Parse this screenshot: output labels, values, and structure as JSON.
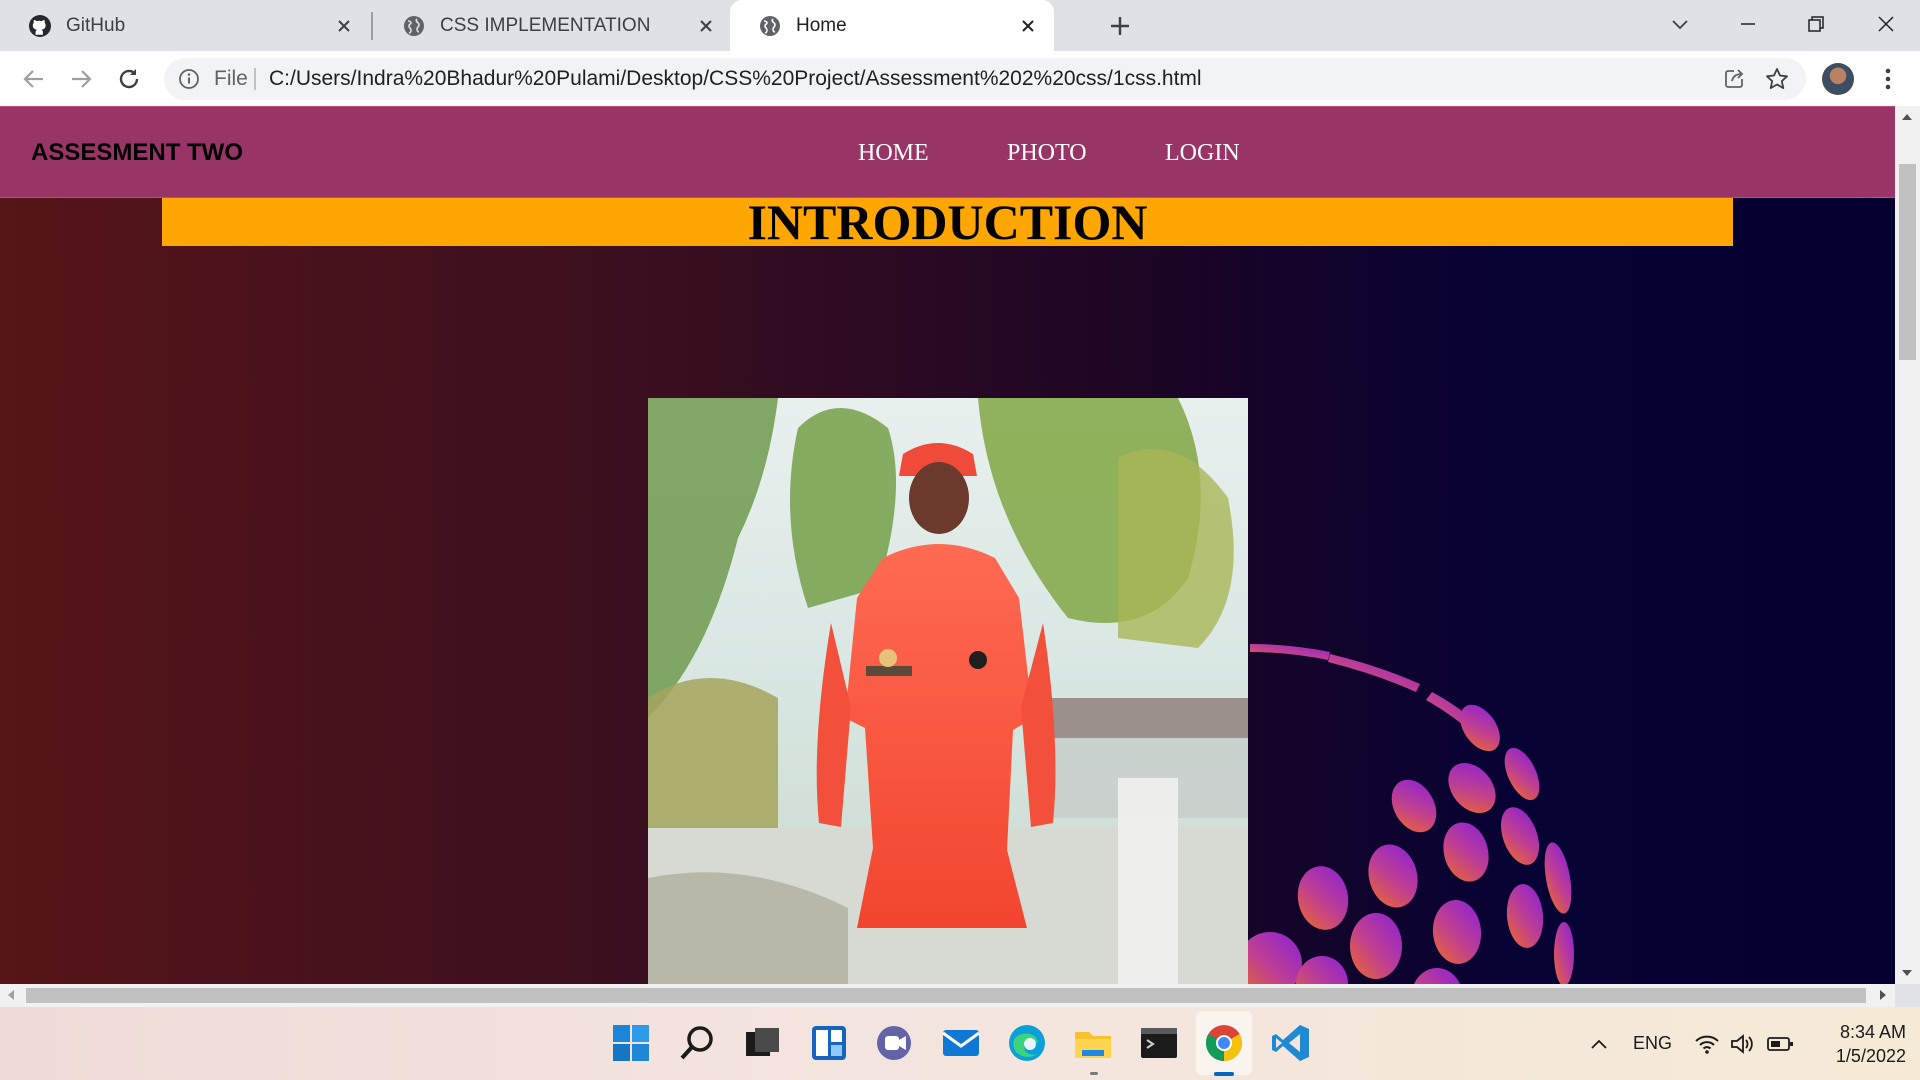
{
  "browser": {
    "tabs": [
      {
        "title": "GitHub",
        "icon": "github-icon"
      },
      {
        "title": "CSS IMPLEMENTATION",
        "icon": "globe-icon"
      },
      {
        "title": "Home",
        "icon": "globe-icon",
        "active": true
      }
    ],
    "address_scheme": "File",
    "url": "C:/Users/Indra%20Bhadur%20Pulami/Desktop/CSS%20Project/Assessment%202%20css/1css.html"
  },
  "page": {
    "brand": "ASSESMENT TWO",
    "nav": [
      "HOME",
      "PHOTO",
      "LOGIN"
    ],
    "heading": "INTRODUCTION",
    "colors": {
      "navbar": "#993566",
      "heading_banner": "#ffa600",
      "background_left": "#561518",
      "background_right": "#03002f"
    }
  },
  "taskbar": {
    "apps": [
      "windows-start-icon",
      "search-icon",
      "task-view-icon",
      "widgets-icon",
      "teams-chat-icon",
      "mail-icon",
      "edge-icon",
      "file-explorer-icon",
      "terminal-icon",
      "chrome-icon",
      "vscode-icon"
    ],
    "language": "ENG",
    "time": "8:34 AM",
    "date": "1/5/2022"
  }
}
